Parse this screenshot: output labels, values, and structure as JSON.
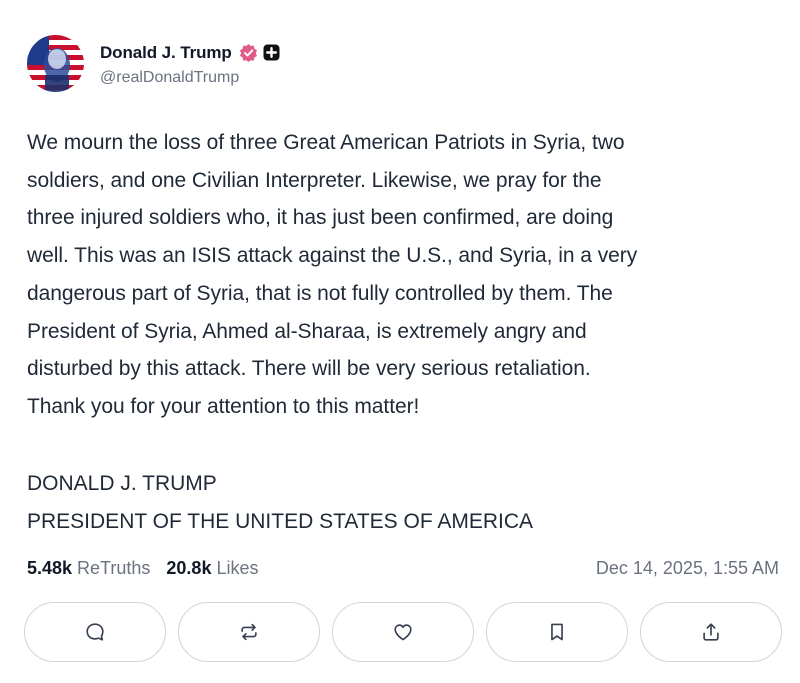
{
  "author": {
    "display_name": "Donald J. Trump",
    "handle": "@realDonaldTrump",
    "verified_icon": "verified-badge-icon",
    "badge_icon": "plus-badge-icon",
    "verified_color": "#e05a8a"
  },
  "post": {
    "lines": [
      "We mourn the loss of three Great American Patriots in Syria, two",
      "soldiers, and one Civilian Interpreter. Likewise, we pray for the",
      "three injured soldiers who, it has just been confirmed, are doing",
      "well. This was an ISIS attack against the U.S., and Syria, in a very",
      "dangerous part of Syria, that is not fully controlled by them. The",
      "President of Syria, Ahmed al-Sharaa, is extremely angry and",
      "disturbed by this attack. There will be very serious retaliation.",
      "Thank you for your attention to this matter!"
    ],
    "signature": [
      "DONALD J. TRUMP",
      "PRESIDENT OF THE UNITED STATES OF AMERICA"
    ]
  },
  "stats": {
    "retruths_count": "5.48k",
    "retruths_label": "ReTruths",
    "likes_count": "20.8k",
    "likes_label": "Likes",
    "timestamp": "Dec 14, 2025, 1:55 AM"
  },
  "actions": [
    {
      "icon": "reply-icon"
    },
    {
      "icon": "retruth-icon"
    },
    {
      "icon": "like-icon"
    },
    {
      "icon": "bookmark-icon"
    },
    {
      "icon": "share-icon"
    }
  ]
}
